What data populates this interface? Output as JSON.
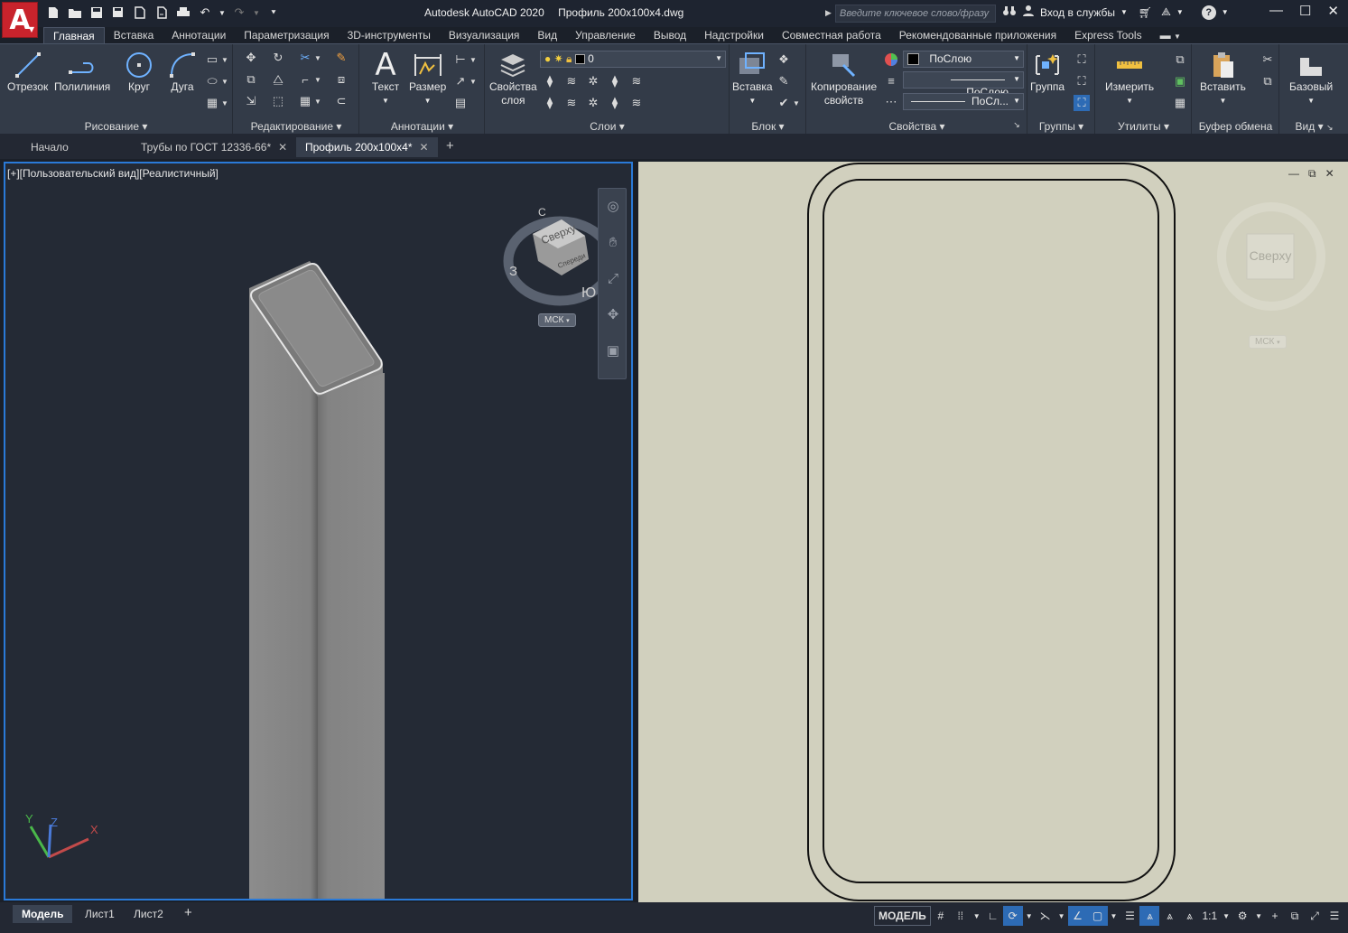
{
  "titlebar": {
    "app_name": "Autodesk AutoCAD 2020",
    "file_name": "Профиль 200x100x4.dwg",
    "search_placeholder": "Введите ключевое слово/фразу",
    "sign_in": "Вход в службы",
    "logo_letter": "A"
  },
  "menu_tabs": [
    "Главная",
    "Вставка",
    "Аннотации",
    "Параметризация",
    "3D-инструменты",
    "Визуализация",
    "Вид",
    "Управление",
    "Вывод",
    "Надстройки",
    "Совместная работа",
    "Рекомендованные приложения",
    "Express Tools"
  ],
  "ribbon": {
    "draw": {
      "title": "Рисование",
      "line": "Отрезок",
      "polyline": "Полилиния",
      "circle": "Круг",
      "arc": "Дуга"
    },
    "modify": {
      "title": "Редактирование"
    },
    "annotation": {
      "title": "Аннотации",
      "text": "Текст",
      "dimension": "Размер"
    },
    "layers": {
      "title": "Слои",
      "props_line1": "Свойства",
      "props_line2": "слоя",
      "current_layer": "0"
    },
    "block": {
      "title": "Блок",
      "insert": "Вставка"
    },
    "properties": {
      "title": "Свойства",
      "match_line1": "Копирование",
      "match_line2": "свойств",
      "color": "ПоСлою",
      "linetype": "ПоСлою",
      "lineweight": "ПоСл..."
    },
    "groups": {
      "title": "Группы",
      "group": "Группа"
    },
    "utilities": {
      "title": "Утилиты",
      "measure": "Измерить"
    },
    "clipboard": {
      "title": "Буфер обмена",
      "paste": "Вставить"
    },
    "view": {
      "title": "Вид",
      "base": "Базовый"
    }
  },
  "doc_tabs": {
    "start": "Начало",
    "tab1": "Трубы по ГОСТ 12336-66*",
    "tab2": "Профиль 200x100x4*"
  },
  "viewport_left": {
    "label": "[+][Пользовательский вид][Реалистичный]",
    "viewcube_face": "Сверху",
    "viewcube_side": "Спереди",
    "compass": {
      "n": "С",
      "e": "В",
      "s": "Ю",
      "w": "З"
    },
    "ucs_button": "МСК",
    "axes": {
      "x": "X",
      "y": "Y",
      "z": "Z"
    }
  },
  "viewport_right": {
    "viewcube_face": "Сверху",
    "ucs_button": "МСК"
  },
  "layout_tabs": [
    "Модель",
    "Лист1",
    "Лист2"
  ],
  "status": {
    "model": "МОДЕЛЬ",
    "scale": "1:1"
  },
  "colors": {
    "accent": "#2a7ad8",
    "app_red": "#c8232c",
    "viewport_dark": "#242a35",
    "viewport_light": "#d1d0be",
    "profile_gray": "#858585"
  }
}
